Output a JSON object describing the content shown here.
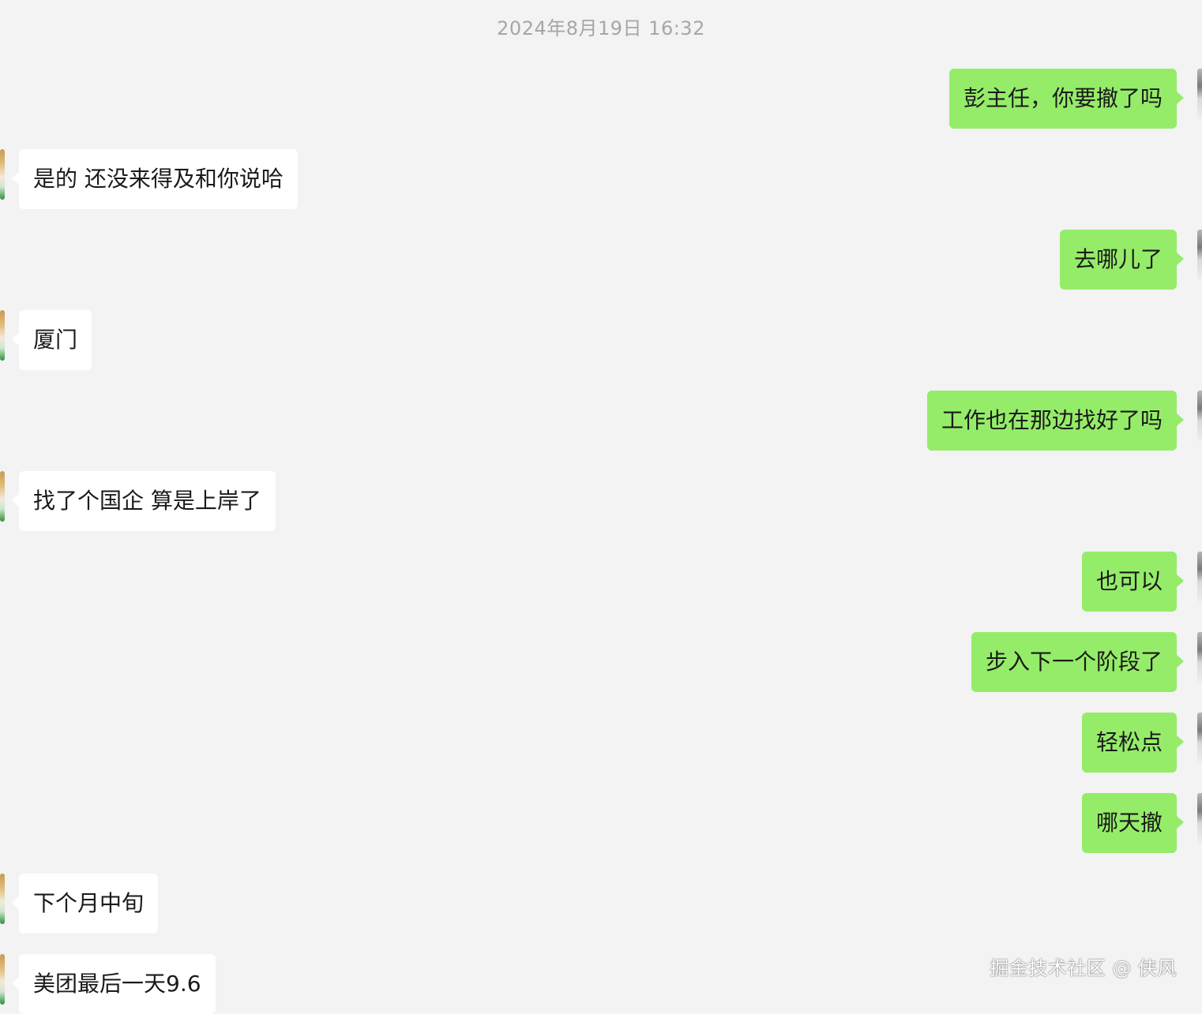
{
  "chat": {
    "timestamp": "2024年8月19日 16:32",
    "messages": [
      {
        "side": "mine",
        "text": "彭主任，你要撤了吗"
      },
      {
        "side": "theirs",
        "text": "是的 还没来得及和你说哈"
      },
      {
        "side": "mine",
        "text": "去哪儿了"
      },
      {
        "side": "theirs",
        "text": "厦门"
      },
      {
        "side": "mine",
        "text": "工作也在那边找好了吗"
      },
      {
        "side": "theirs",
        "text": "找了个国企 算是上岸了"
      },
      {
        "side": "mine",
        "text": "也可以"
      },
      {
        "side": "mine",
        "text": "步入下一个阶段了"
      },
      {
        "side": "mine",
        "text": "轻松点"
      },
      {
        "side": "mine",
        "text": "哪天撤"
      },
      {
        "side": "theirs",
        "text": "下个月中旬"
      },
      {
        "side": "theirs",
        "text": "美团最后一天9.6"
      }
    ]
  },
  "watermark": {
    "text": "掘金技术社区 @ 侠风"
  },
  "colors": {
    "background": "#f3f3f3",
    "my_bubble": "#95ec69",
    "their_bubble": "#ffffff",
    "timestamp": "#a6a6a6"
  }
}
